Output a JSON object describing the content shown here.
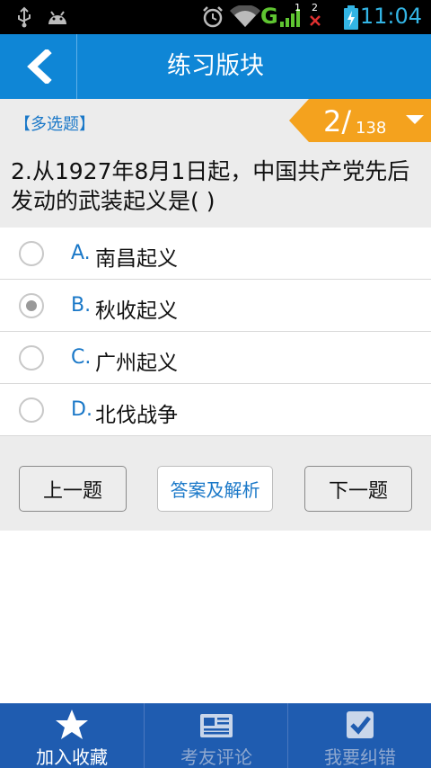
{
  "status_bar": {
    "time": "11:04",
    "network_letter": "G",
    "sim_badge_1": "1",
    "sim_badge_2": "2"
  },
  "header": {
    "title": "练习版块"
  },
  "question": {
    "type": "【多选题】",
    "current": "2/",
    "total": "138",
    "text": "2.从1927年8月1日起，中国共产党先后发动的武装起义是( )",
    "options": [
      {
        "letter": "A.",
        "text": "南昌起义",
        "checked": false
      },
      {
        "letter": "B.",
        "text": "秋收起义",
        "checked": true
      },
      {
        "letter": "C.",
        "text": "广州起义",
        "checked": false
      },
      {
        "letter": "D.",
        "text": "北伐战争",
        "checked": false
      }
    ]
  },
  "buttons": {
    "prev": "上一题",
    "answer": "答案及解析",
    "next": "下一题"
  },
  "tabs": [
    {
      "label": "加入收藏",
      "icon": "star-icon",
      "active": true
    },
    {
      "label": "考友评论",
      "icon": "newspaper-icon",
      "active": false
    },
    {
      "label": "我要纠错",
      "icon": "checkbox-icon",
      "active": false
    }
  ],
  "colors": {
    "primary": "#0f86d6",
    "accent_orange": "#f4a21e",
    "tab_bar": "#1f5cb0",
    "link_blue": "#1a78c8"
  }
}
